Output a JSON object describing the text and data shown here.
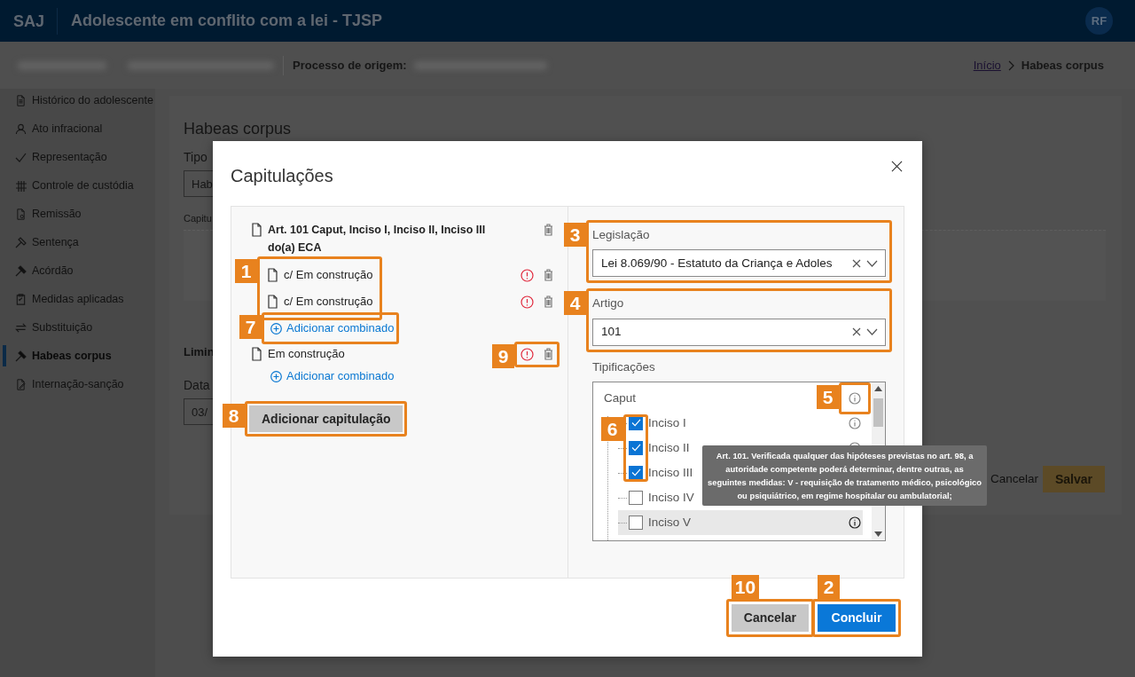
{
  "header": {
    "logo": "SAJ",
    "title": "Adolescente em conflito com a lei - TJSP",
    "avatar": "RF"
  },
  "subheader": {
    "origin_label": "Processo de origem:",
    "breadcrumb": [
      {
        "label": "Início",
        "kind": "link"
      },
      {
        "label": "Habeas corpus",
        "kind": "current"
      }
    ]
  },
  "sidebar": {
    "items": [
      {
        "label": "Histórico do adolescente",
        "selected": false
      },
      {
        "label": "Ato infracional",
        "selected": false
      },
      {
        "label": "Representação",
        "selected": false
      },
      {
        "label": "Controle de custódia",
        "selected": false
      },
      {
        "label": "Remissão",
        "selected": false
      },
      {
        "label": "Sentença",
        "selected": false
      },
      {
        "label": "Acórdão",
        "selected": false
      },
      {
        "label": "Medidas aplicadas",
        "selected": false
      },
      {
        "label": "Substituição",
        "selected": false
      },
      {
        "label": "Habeas corpus",
        "selected": true
      },
      {
        "label": "Internação-sanção",
        "selected": false
      }
    ]
  },
  "page": {
    "title": "Habeas corpus",
    "type_label": "Tipo",
    "type_value": "Hab",
    "capitulation_label": "Capitu",
    "injunction_heading": "Limin",
    "date_label": "Data",
    "date_value": "03/",
    "buttons": [
      {
        "label": "Cancelar",
        "kind": "link"
      },
      {
        "label": "Salvar",
        "kind": "primary"
      }
    ]
  },
  "modal": {
    "title": "Capitulações",
    "capitulations": [
      {
        "text": "Art. 101 Caput, Inciso I, Inciso II, Inciso III do(a) ECA",
        "error": false,
        "combined": [
          {
            "text": "c/ Em construção",
            "error": true
          },
          {
            "text": "c/ Em construção",
            "error": true
          }
        ],
        "add_combined": "Adicionar combinado"
      },
      {
        "text": "Em construção",
        "error": true,
        "add_combined": "Adicionar combinado"
      }
    ],
    "add_button": "Adicionar capitulação",
    "legislation": {
      "label": "Legislação",
      "value": "Lei 8.069/90 - Estatuto da Criança e Adoles"
    },
    "article": {
      "label": "Artigo",
      "value": "101"
    },
    "typifications": {
      "label": "Tipificações",
      "tree": [
        {
          "label": "Caput",
          "info": true,
          "children": [
            {
              "label": "Inciso I",
              "checked": true,
              "hovered": false,
              "info": true
            },
            {
              "label": "Inciso II",
              "checked": true,
              "hovered": false,
              "info": true
            },
            {
              "label": "Inciso III",
              "checked": true,
              "hovered": false,
              "info": false
            },
            {
              "label": "Inciso IV",
              "checked": false,
              "hovered": false,
              "info": false
            },
            {
              "label": "Inciso V",
              "checked": false,
              "hovered": true,
              "info": true
            }
          ]
        }
      ]
    },
    "tooltip": "Art. 101. Verificada qualquer das hipóteses previstas no art. 98, a autoridade competente poderá determinar, dentre outras, as seguintes medidas: V - requisição de tratamento médico, psicológico ou psiquiátrico, em regime hospitalar ou ambulatorial;",
    "buttons": [
      {
        "label": "Cancelar",
        "kind": "secondary"
      },
      {
        "label": "Concluir",
        "kind": "primary"
      }
    ]
  },
  "callouts": [
    {
      "number": "1"
    },
    {
      "number": "2"
    },
    {
      "number": "3"
    },
    {
      "number": "4"
    },
    {
      "number": "5"
    },
    {
      "number": "6"
    },
    {
      "number": "7"
    },
    {
      "number": "8"
    },
    {
      "number": "9"
    },
    {
      "number": "10"
    }
  ]
}
